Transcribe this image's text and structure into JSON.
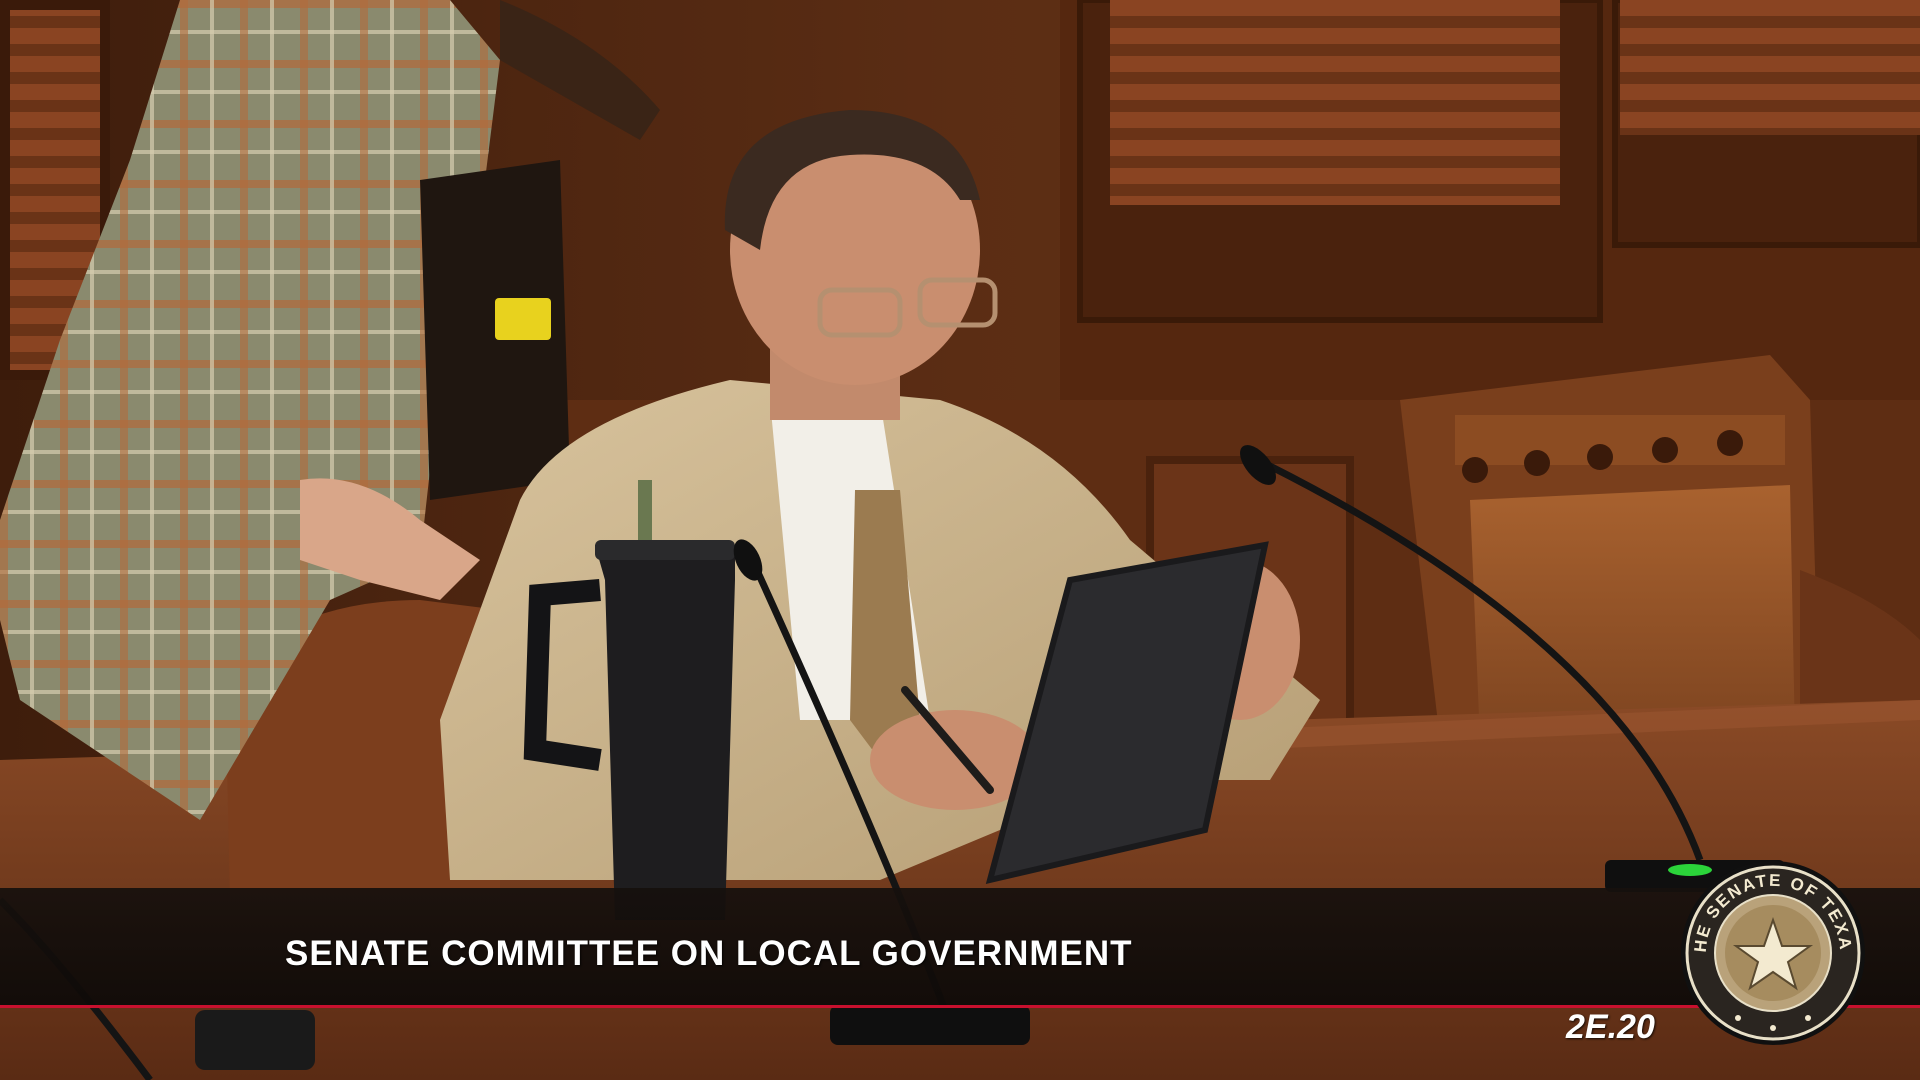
{
  "broadcast": {
    "caption_title": "SENATE COMMITTEE ON LOCAL GOVERNMENT",
    "timecode": "2E.20",
    "seal_text": "THE SENATE OF TEXAS",
    "rule_color": "#c8102e"
  },
  "scene": {
    "description_icons": [
      "person-icon",
      "microphone-icon",
      "tumbler-icon",
      "tablet-icon",
      "chair-icon"
    ]
  }
}
